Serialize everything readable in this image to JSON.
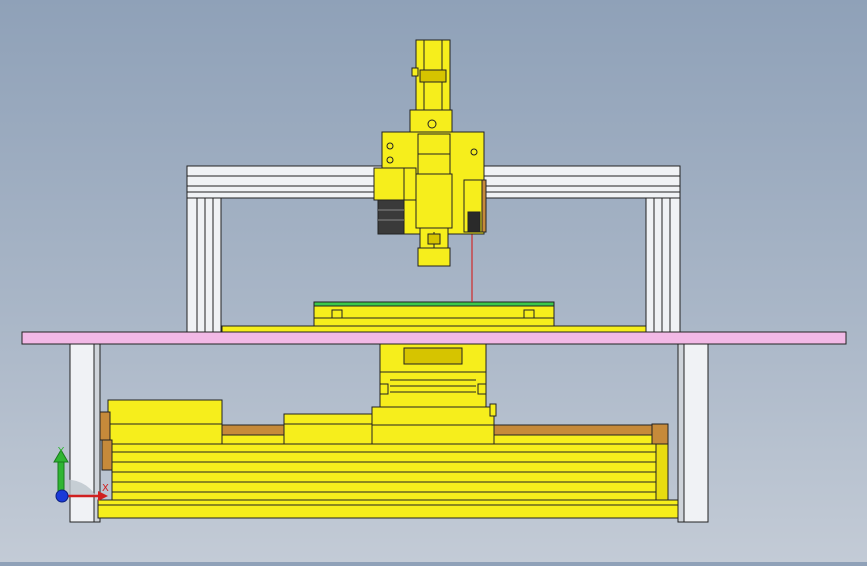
{
  "view": {
    "background_top": "#8fa1b8",
    "background_bottom": "#c3cbd6"
  },
  "colors": {
    "machine_yellow": "#f6ee1c",
    "machine_yellow_dark": "#d6c400",
    "frame_white": "#f0f2f5",
    "table_pink": "#f2b9e6",
    "rail_brown": "#c68a3a",
    "pcb_green": "#3cc84a",
    "laser_red": "#d02a2a",
    "outline": "#222222"
  },
  "triad": {
    "y_label": "Y",
    "x_label": "X",
    "y_color": "#2fb533",
    "x_color": "#d02020",
    "z_color": "#1a3ad8"
  }
}
